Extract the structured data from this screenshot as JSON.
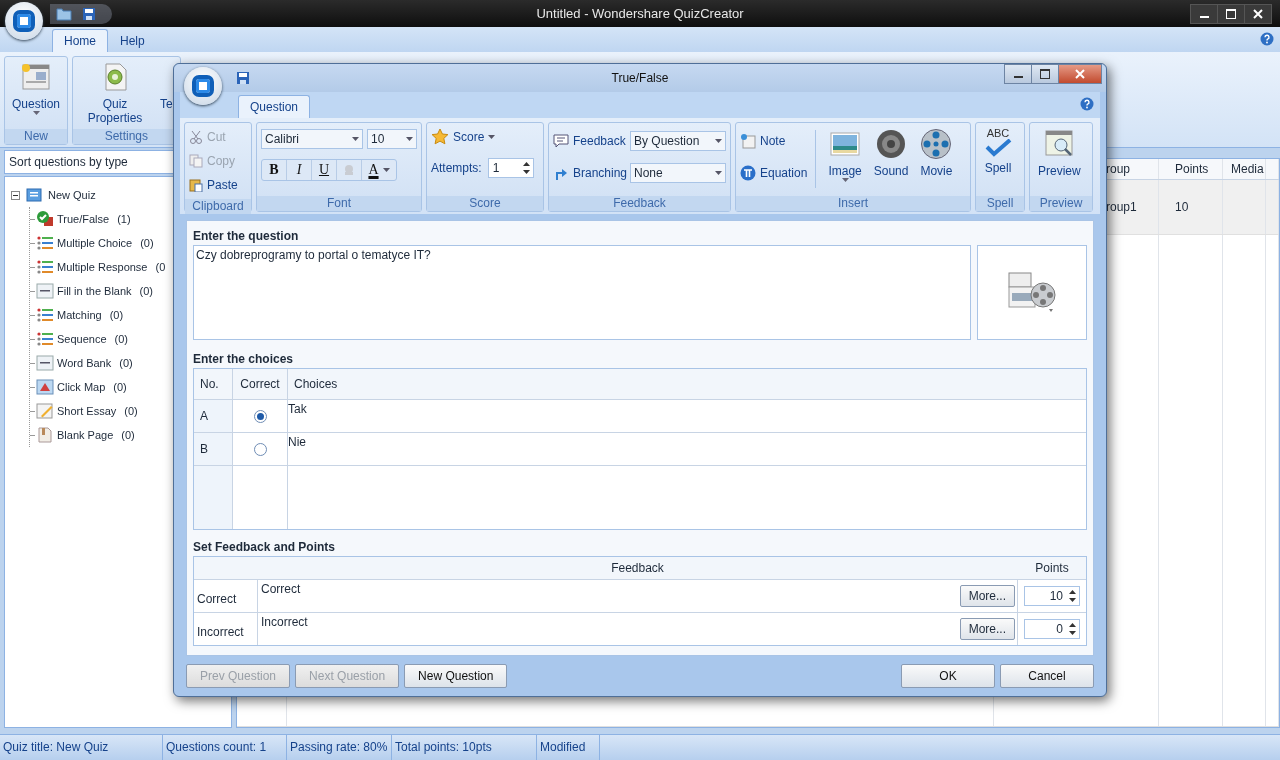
{
  "window": {
    "title": "Untitled - Wondershare QuizCreator"
  },
  "tabs": [
    {
      "label": "Home",
      "selected": true
    },
    {
      "label": "Help",
      "selected": false
    }
  ],
  "ribbon": {
    "groups": [
      {
        "label": "New",
        "buttons": [
          {
            "label": "Question",
            "kind": "question"
          }
        ]
      },
      {
        "label": "Settings",
        "buttons": [
          {
            "label": "Quiz Properties",
            "kind": "properties"
          },
          {
            "label": "Te",
            "kind": "cut"
          }
        ]
      }
    ]
  },
  "sidebar": {
    "sort": "Sort questions by type",
    "tree": {
      "label": "New Quiz",
      "expanded": true,
      "children": [
        {
          "label": "True/False",
          "count": "(1)",
          "kind": "truefalse"
        },
        {
          "label": "Multiple Choice",
          "count": "(0)",
          "kind": "list"
        },
        {
          "label": "Multiple Response",
          "count": "(0",
          "kind": "list"
        },
        {
          "label": "Fill in the Blank",
          "count": "(0)",
          "kind": "blank"
        },
        {
          "label": "Matching",
          "count": "(0)",
          "kind": "list"
        },
        {
          "label": "Sequence",
          "count": "(0)",
          "kind": "list"
        },
        {
          "label": "Word Bank",
          "count": "(0)",
          "kind": "blank"
        },
        {
          "label": "Click Map",
          "count": "(0)",
          "kind": "map"
        },
        {
          "label": "Short Essay",
          "count": "(0)",
          "kind": "essay"
        },
        {
          "label": "Blank Page",
          "count": "(0)",
          "kind": "page"
        }
      ]
    }
  },
  "question_table": {
    "columns": [
      "roup",
      "Points",
      "Media"
    ],
    "rows": [
      {
        "cells": [
          "roup1",
          "10"
        ]
      }
    ]
  },
  "status_bar": [
    "Quiz title: New Quiz",
    "Questions count: 1",
    "Passing rate: 80%",
    "Total points: 10pts",
    "Modified"
  ],
  "dialog": {
    "title": "True/False",
    "tabs": [
      {
        "label": "Question",
        "selected": true
      }
    ],
    "ribbon": {
      "clipboard": {
        "label": "Clipboard",
        "items": [
          {
            "label": "Cut",
            "disabled": true
          },
          {
            "label": "Copy",
            "disabled": true
          },
          {
            "label": "Paste",
            "disabled": false
          }
        ]
      },
      "font": {
        "label": "Font",
        "family": "Calibri",
        "size": "10",
        "bold": "B",
        "italic": "I",
        "underline": "U",
        "color_letter": "A"
      },
      "score": {
        "label": "Score",
        "button": "Score",
        "attempts_label": "Attempts:",
        "attempts": "1"
      },
      "feedback": {
        "label": "Feedback",
        "rows": [
          {
            "label": "Feedback",
            "value": "By Question"
          },
          {
            "label": "Branching",
            "value": "None"
          }
        ]
      },
      "insert": {
        "label": "Insert",
        "small": [
          {
            "label": "Note",
            "kind": "note"
          },
          {
            "label": "Equation",
            "kind": "equation"
          }
        ],
        "large": [
          {
            "label": "Image",
            "kind": "image"
          },
          {
            "label": "Sound",
            "kind": "sound"
          },
          {
            "label": "Movie",
            "kind": "movie"
          }
        ]
      },
      "spell": {
        "label": "Spell",
        "button": "Spell",
        "icon_text": "ABC"
      },
      "preview": {
        "label": "Preview",
        "button": "Preview"
      }
    },
    "question": {
      "label": "Enter the question",
      "text": "Czy dobreprogramy to portal o tematyce IT?"
    },
    "choices": {
      "label": "Enter the choices",
      "columns": [
        "No.",
        "Correct",
        "Choices"
      ],
      "rows": [
        {
          "no": "A",
          "correct": true,
          "text": "Tak"
        },
        {
          "no": "B",
          "correct": false,
          "text": "Nie"
        }
      ]
    },
    "feedback": {
      "label": "Set Feedback and Points",
      "columns": [
        "Feedback",
        "Points"
      ],
      "rows": [
        {
          "label": "Correct",
          "feedback": "Correct",
          "more": "More...",
          "points": "10"
        },
        {
          "label": "Incorrect",
          "feedback": "Incorrect",
          "more": "More...",
          "points": "0"
        }
      ]
    },
    "nav_buttons": [
      {
        "label": "Prev Question",
        "disabled": true
      },
      {
        "label": "Next Question",
        "disabled": true
      },
      {
        "label": "New Question",
        "disabled": false
      }
    ],
    "ok": "OK",
    "cancel": "Cancel"
  }
}
